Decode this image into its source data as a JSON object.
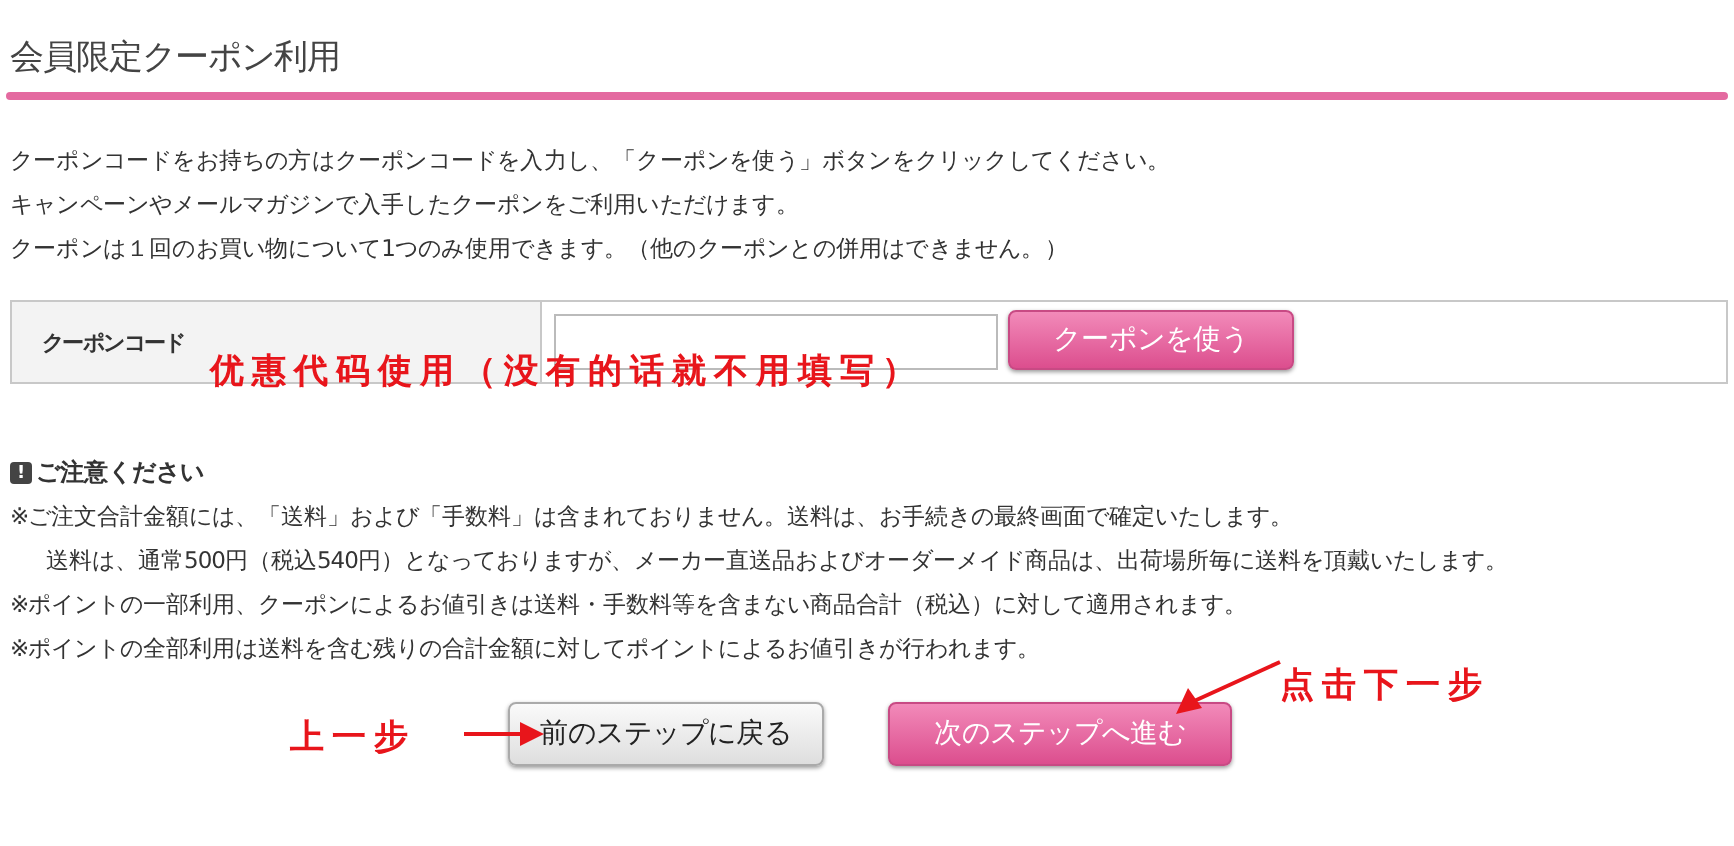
{
  "page": {
    "title": "会員限定クーポン利用"
  },
  "intro": [
    "クーポンコードをお持ちの方はクーポンコードを入力し、「クーポンを使う」ボタンをクリックしてください。",
    "キャンペーンやメールマガジンで入手したクーポンをご利用いただけます。",
    "クーポンは１回のお買い物について1つのみ使用できます。（他のクーポンとの併用はできません。）"
  ],
  "coupon_form": {
    "label": "クーポンコード",
    "button": "クーポンを使う"
  },
  "notice": {
    "icon": "!",
    "title": "ご注意ください",
    "lines": [
      {
        "text": "※ご注文合計金額には、「送料」および「手数料」は含まれておりません。送料は、お手続きの最終画面で確定いたします。",
        "indent": false
      },
      {
        "text": "送料は、通常500円（税込540円）となっておりますが、メーカー直送品およびオーダーメイド商品は、出荷場所毎に送料を頂戴いたします。",
        "indent": true
      },
      {
        "text": "※ポイントの一部利用、クーポンによるお値引きは送料・手数料等を含まない商品合計（税込）に対して適用されます。",
        "indent": false
      },
      {
        "text": "※ポイントの全部利用は送料を含む残りの合計金額に対してポイントによるお値引きが行われます。",
        "indent": false
      }
    ]
  },
  "nav_buttons": [
    {
      "label": "前のステップに戻る",
      "kind": "secondary"
    },
    {
      "label": "次のステップへ進む",
      "kind": "primary"
    }
  ],
  "annotations": [
    {
      "text": "优惠代码使用（没有的话就不用填写）"
    },
    {
      "text": "上一步",
      "arrow": true
    },
    {
      "text": "点击下一步",
      "arrow": true
    }
  ]
}
